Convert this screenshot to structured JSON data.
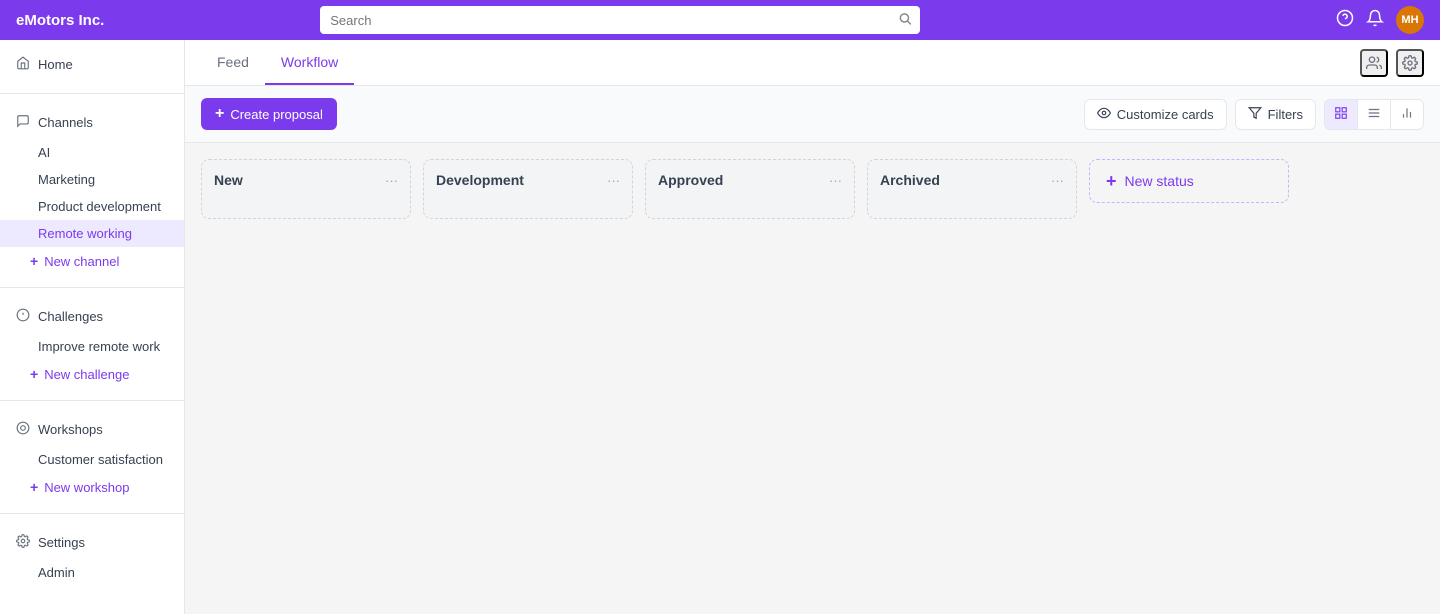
{
  "app": {
    "title": "eMotors Inc."
  },
  "topbar": {
    "search_placeholder": "Search",
    "help_icon": "?",
    "notifications_icon": "🔔",
    "avatar_initials": "MH",
    "avatar_bg": "#d97706"
  },
  "sidebar": {
    "home_label": "Home",
    "channels_label": "Channels",
    "channel_items": [
      "AI",
      "Marketing",
      "Product development",
      "Remote working"
    ],
    "active_channel": "Remote working",
    "new_channel_label": "New channel",
    "challenges_label": "Challenges",
    "challenge_items": [
      "Improve remote work"
    ],
    "new_challenge_label": "New challenge",
    "workshops_label": "Workshops",
    "workshop_items": [
      "Customer satisfaction"
    ],
    "new_workshop_label": "New workshop",
    "settings_label": "Settings",
    "settings_items": [
      "Admin"
    ]
  },
  "tabs": {
    "items": [
      "Feed",
      "Workflow"
    ],
    "active": "Workflow"
  },
  "toolbar": {
    "create_label": "Create proposal",
    "customize_label": "Customize cards",
    "filters_label": "Filters"
  },
  "kanban": {
    "columns": [
      {
        "id": "new",
        "title": "New"
      },
      {
        "id": "development",
        "title": "Development"
      },
      {
        "id": "approved",
        "title": "Approved"
      },
      {
        "id": "archived",
        "title": "Archived"
      }
    ],
    "new_status_label": "New status"
  }
}
